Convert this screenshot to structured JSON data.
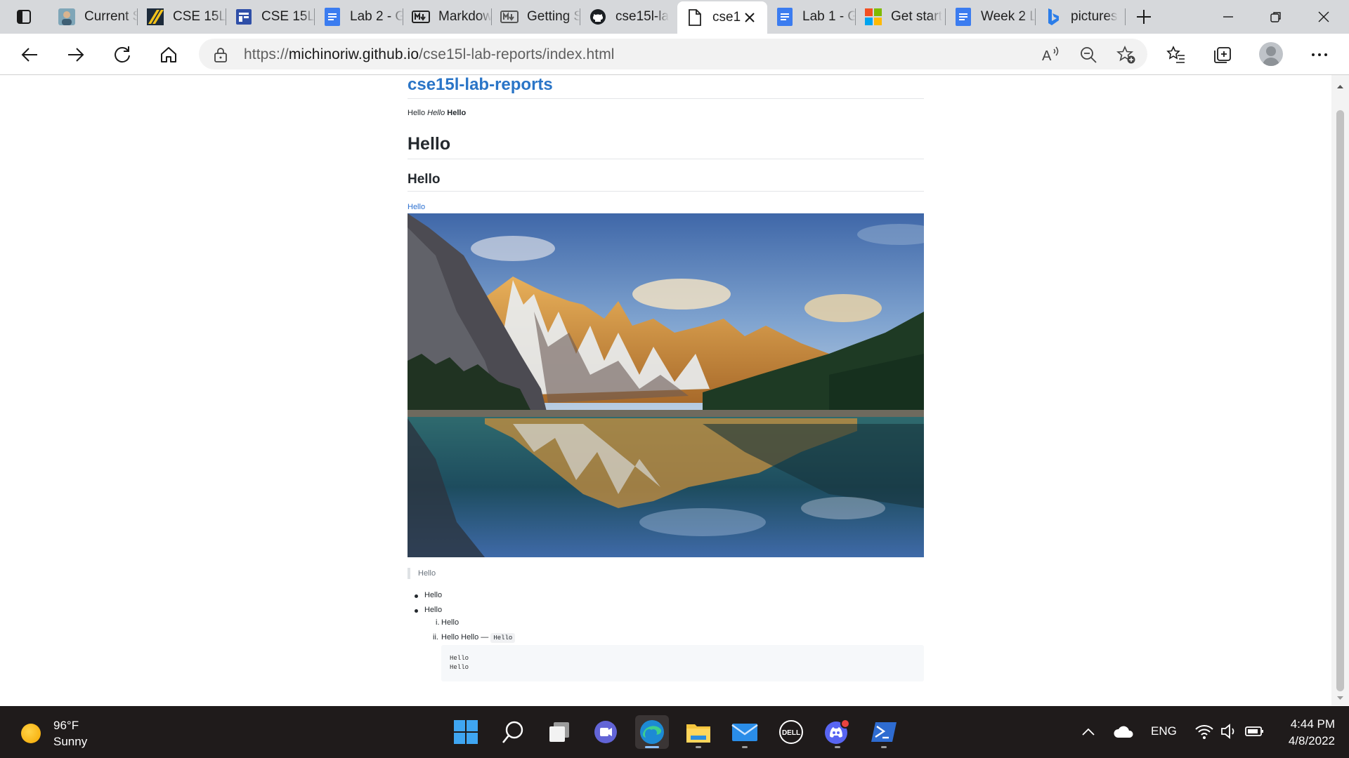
{
  "browser": {
    "tabs": [
      {
        "title": "Current S",
        "icon": "person-photo-icon",
        "active": false
      },
      {
        "title": "CSE 15L",
        "icon": "stripes-logo-icon",
        "active": false
      },
      {
        "title": "CSE 15L",
        "icon": "calendar-app-icon",
        "active": false
      },
      {
        "title": "Lab 2 - G",
        "icon": "google-docs-icon",
        "active": false
      },
      {
        "title": "Markdow",
        "icon": "markdown-icon",
        "active": false
      },
      {
        "title": "Getting S",
        "icon": "markdown-icon",
        "active": false
      },
      {
        "title": "cse15l-la",
        "icon": "github-icon",
        "active": false
      },
      {
        "title": "cse1",
        "icon": "document-icon",
        "active": true
      },
      {
        "title": "Lab 1 - G",
        "icon": "google-docs-icon",
        "active": false
      },
      {
        "title": "Get start",
        "icon": "microsoft-icon",
        "active": false
      },
      {
        "title": "Week 2 L",
        "icon": "google-docs-icon",
        "active": false
      },
      {
        "title": "pictures",
        "icon": "bing-icon",
        "active": false
      }
    ],
    "url_prefix": "https://",
    "url_host": "michinoriw.github.io",
    "url_path": "/cse15l-lab-reports/index.html",
    "read_aloud_label": "A"
  },
  "page": {
    "site_title": "cse15l-lab-reports",
    "p1_plain": "Hello ",
    "p1_italic": "Hello",
    "p1_bold": "Hello",
    "h1": "Hello",
    "h2": "Hello",
    "link": "Hello",
    "quote": "Hello",
    "list": {
      "item1": "Hello",
      "item2": "Hello",
      "sub1_marker": "i.",
      "sub1": "Hello",
      "sub2_marker": "ii.",
      "sub2": "Hello Hello — ",
      "sub2_code": "Hello"
    },
    "code_lines": [
      "Hello",
      "Hello"
    ]
  },
  "taskbar": {
    "temperature": "96°F",
    "condition": "Sunny",
    "language": "ENG",
    "time": "4:44 PM",
    "date": "4/8/2022"
  }
}
